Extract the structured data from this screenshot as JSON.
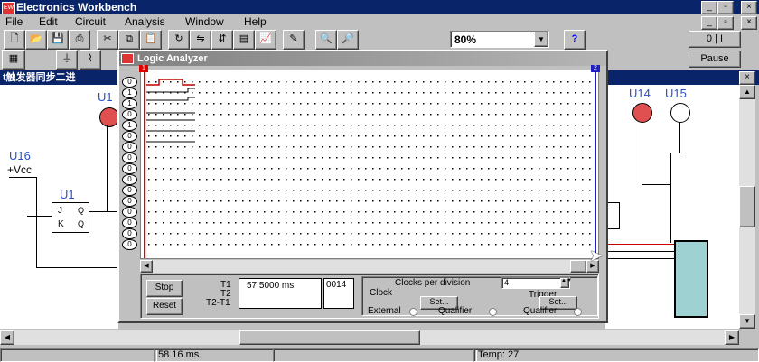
{
  "window": {
    "title": "Electronics Workbench"
  },
  "menu": [
    "File",
    "Edit",
    "Circuit",
    "Analysis",
    "Window",
    "Help"
  ],
  "toolbar": {
    "zoom_value": "80%",
    "help_label": "?",
    "pause_label": "Pause",
    "power_label": "0 | I"
  },
  "document": {
    "title": "t触发器同步二进"
  },
  "circuit": {
    "labels": [
      "U16",
      "+Vcc",
      "U1",
      "U1",
      "U14",
      "U15"
    ],
    "gate_pins": [
      "J",
      "K",
      "Q",
      "Q"
    ]
  },
  "logic_analyzer": {
    "title": "Logic Analyzer",
    "cursor_labels": [
      "1",
      "2"
    ],
    "pins": [
      "0",
      "1",
      "1",
      "0",
      "1",
      "0",
      "0",
      "0",
      "0",
      "0",
      "0",
      "0",
      "0",
      "0",
      "0",
      "0"
    ],
    "buttons": {
      "stop": "Stop",
      "reset": "Reset"
    },
    "readouts": {
      "t1_label": "T1",
      "t2_label": "T2",
      "t2t1_label": "T2-T1",
      "t1_value": "57.5000 ms",
      "hex_value": "0014"
    },
    "clock": {
      "clocks_per_division_label": "Clocks per division",
      "clocks_per_division_value": "4",
      "clock_label": "Clock",
      "trigger_label": "Trigger",
      "set_label": "Set...",
      "external_label": "External",
      "qualifier_label": "Qualifier"
    }
  },
  "status": {
    "time": "58.16 ms",
    "temp": "Temp:  27"
  }
}
